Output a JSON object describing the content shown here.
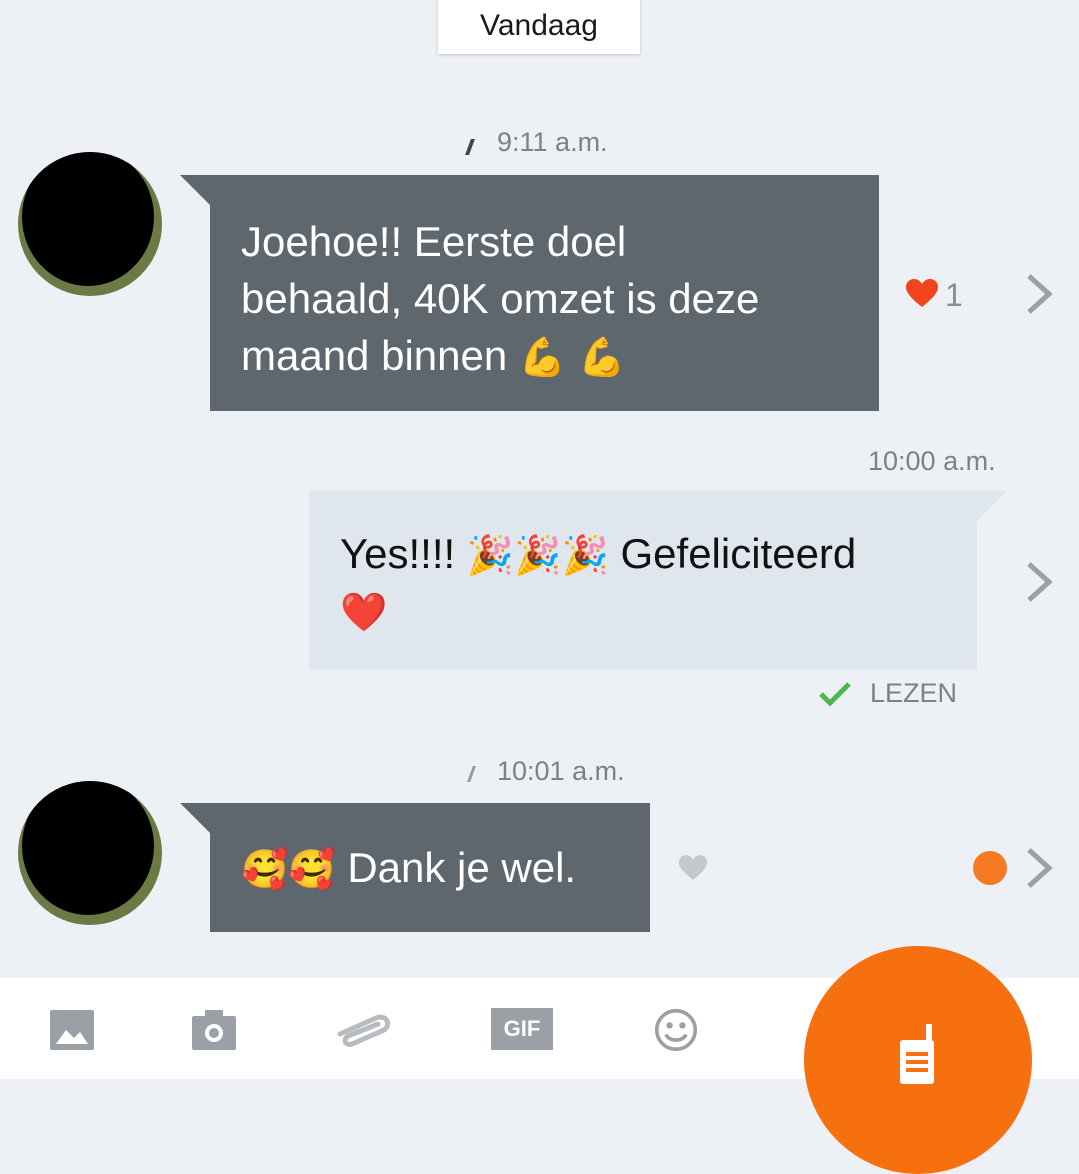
{
  "date_separator": "Vandaag",
  "messages": [
    {
      "direction": "incoming",
      "time": "9:11 a.m.",
      "line1": "Joehoe!! Eerste doel",
      "line2": "behaald, 40K omzet is deze",
      "line3": "maand binnen",
      "emojis": "💪 💪",
      "reaction_icon": "red-heart",
      "reaction_count": "1"
    },
    {
      "direction": "outgoing",
      "time": "10:00 a.m.",
      "text": "Yes!!!!",
      "emojis": "🎉🎉🎉",
      "text_after": "Gefeliciteerd",
      "line2_emoji": "❤️",
      "status": "LEZEN"
    },
    {
      "direction": "incoming",
      "time": "10:01 a.m.",
      "emojis": "🥰🥰",
      "text": "Dank je wel.",
      "reaction_icon": "grey-heart"
    }
  ],
  "toolbar": {
    "items": [
      "image-icon",
      "camera-icon",
      "paperclip-icon",
      "gif-icon",
      "smiley-icon"
    ],
    "gif_label": "GIF"
  },
  "colors": {
    "background": "#edf0f4",
    "incoming_bubble": "#5f676e",
    "outgoing_bubble": "#dfe6ee",
    "accent": "#f7700f",
    "heart": "#f0441b",
    "read_check": "#4cb84c"
  }
}
